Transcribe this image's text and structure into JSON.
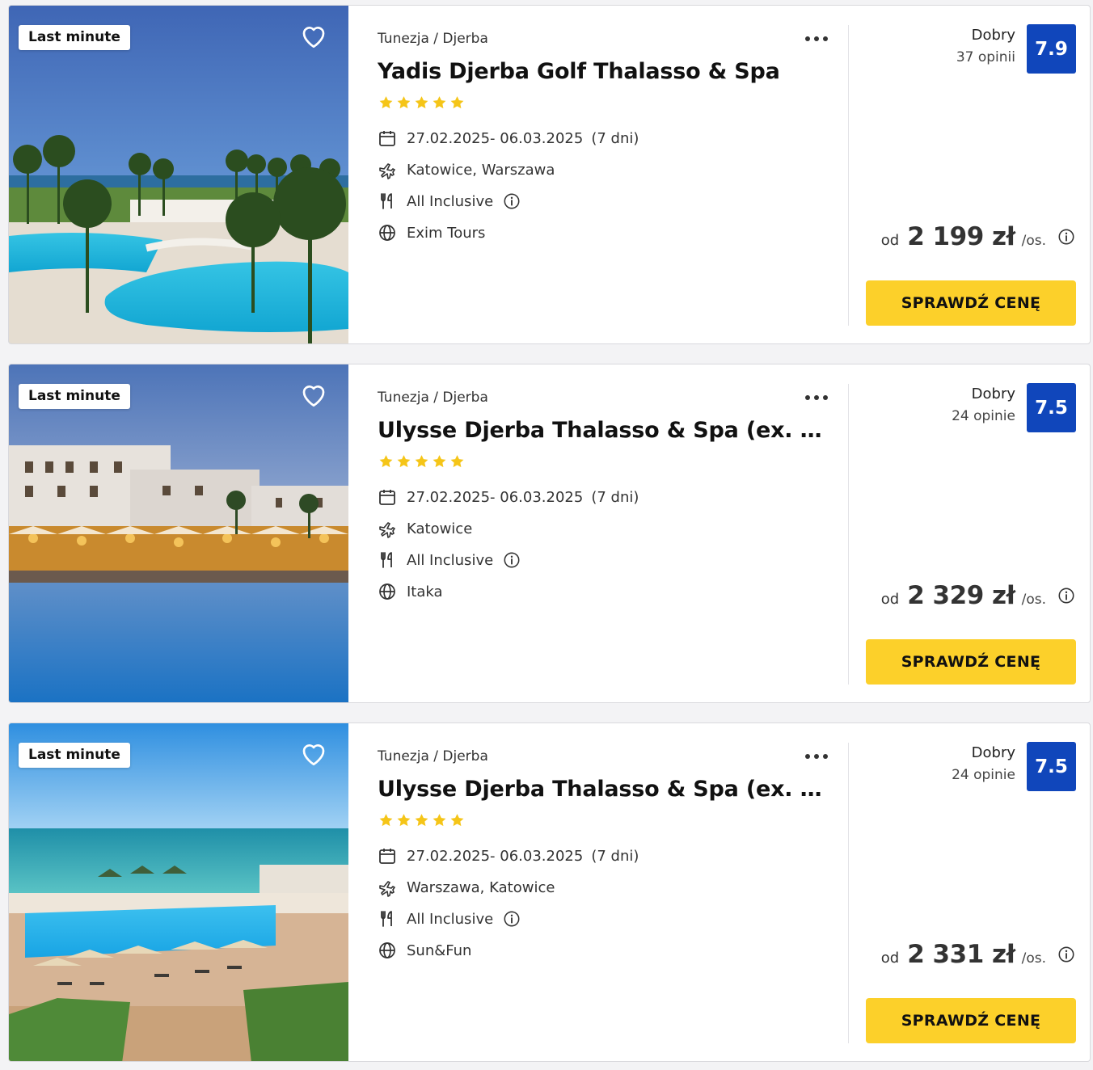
{
  "colors": {
    "accent_yellow": "#fcd02a",
    "score_blue": "#1046bb",
    "star_yellow": "#f5c518"
  },
  "offers": [
    {
      "badge": "Last minute",
      "location": "Tunezja / Djerba",
      "title": "Yadis Djerba Golf Thalasso & Spa",
      "stars": 5,
      "dates": "27.02.2025- 06.03.2025",
      "duration": "(7 dni)",
      "departure": "Katowice, Warszawa",
      "board": "All Inclusive",
      "operator": "Exim Tours",
      "rating_label": "Dobry",
      "rating_count": "37 opinii",
      "score": "7.9",
      "price_prefix": "od",
      "price": "2 199 zł",
      "price_suffix": "/os.",
      "cta": "SPRAWDŹ CENĘ",
      "icons": [
        "heart-icon",
        "more-dots-icon",
        "star-icon",
        "calendar-icon",
        "plane-icon",
        "cutlery-icon",
        "info-icon",
        "globe-icon"
      ]
    },
    {
      "badge": "Last minute",
      "location": "Tunezja / Djerba",
      "title": "Ulysse Djerba Thalasso & Spa (ex. Sen…",
      "stars": 5,
      "dates": "27.02.2025- 06.03.2025",
      "duration": "(7 dni)",
      "departure": "Katowice",
      "board": "All Inclusive",
      "operator": "Itaka",
      "rating_label": "Dobry",
      "rating_count": "24 opinie",
      "score": "7.5",
      "price_prefix": "od",
      "price": "2 329 zł",
      "price_suffix": "/os.",
      "cta": "SPRAWDŹ CENĘ"
    },
    {
      "badge": "Last minute",
      "location": "Tunezja / Djerba",
      "title": "Ulysse Djerba Thalasso & Spa (ex. Sen…",
      "stars": 5,
      "dates": "27.02.2025- 06.03.2025",
      "duration": "(7 dni)",
      "departure": "Warszawa, Katowice",
      "board": "All Inclusive",
      "operator": "Sun&Fun",
      "rating_label": "Dobry",
      "rating_count": "24 opinie",
      "score": "7.5",
      "price_prefix": "od",
      "price": "2 331 zł",
      "price_suffix": "/os.",
      "cta": "SPRAWDŹ CENĘ"
    }
  ]
}
